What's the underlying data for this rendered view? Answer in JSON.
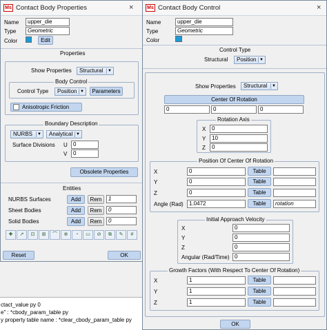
{
  "console": {
    "lines": [
      "ctact_value py 0",
      "e\" : *cbody_param_table py",
      "y property table name : *clear_cbody_param_table py"
    ]
  },
  "left_window": {
    "logo": "Ms",
    "title": "Contact Body Properties",
    "close": "×",
    "name_label": "Name",
    "name_value": "upper_die",
    "type_label": "Type",
    "type_value": "Geometric",
    "color_label": "Color",
    "edit_label": "Edit",
    "color_hex": "#1d9bd6",
    "properties_title": "Properties",
    "show_properties_label": "Show Properties",
    "show_properties_value": "Structural",
    "body_control_title": "Body Control",
    "control_type_label": "Control Type",
    "control_type_value": "Position",
    "parameters_label": "Parameters",
    "anisotropic_label": "Anisotropic Friction",
    "boundary_title": "Boundary Description",
    "nurbs_value": "NURBS",
    "analytical_value": "Analytical",
    "surface_divisions_label": "Surface Divisions",
    "u_label": "U",
    "u_value": "0",
    "v_label": "V",
    "v_value": "0",
    "obsolete_label": "Obsolete Properties",
    "entities_title": "Entities",
    "entity_rows": [
      {
        "label": "NURBS Surfaces",
        "add": "Add",
        "rem": "Rem",
        "value": "1"
      },
      {
        "label": "Sheet Bodies",
        "add": "Add",
        "rem": "Rem",
        "value": "0"
      },
      {
        "label": "Solid Bodies",
        "add": "Add",
        "rem": "Rem",
        "value": "0"
      }
    ],
    "tool_icons": [
      "✚",
      "↗",
      "⊡",
      "⊞",
      "⌒",
      "⊕",
      "◔",
      "▭",
      "⊘",
      "⧉",
      "✎",
      "#"
    ],
    "reset_label": "Reset",
    "ok_label": "OK"
  },
  "right_window": {
    "logo": "Ms",
    "title": "Contact Body Control",
    "close": "×",
    "name_label": "Name",
    "name_value": "upper_die",
    "type_label": "Type",
    "type_value": "Geometric",
    "color_label": "Color",
    "color_hex": "#1d9bd6",
    "control_type_title": "Control Type",
    "structural_label": "Structural",
    "position_value": "Position",
    "show_properties_label": "Show Properties",
    "show_properties_value": "Structural",
    "center_of_rotation_label": "Center Of Rotation",
    "cor_values": [
      "0",
      "0",
      "0"
    ],
    "rotation_axis_title": "Rotation Axis",
    "axis_rows": [
      {
        "label": "X",
        "value": "0"
      },
      {
        "label": "Y",
        "value": "10"
      },
      {
        "label": "Z",
        "value": "0"
      }
    ],
    "poscor_title": "Position Of Center Of Rotation",
    "poscor_rows": [
      {
        "label": "X",
        "value": "0",
        "table": "Table",
        "extra": ""
      },
      {
        "label": "Y",
        "value": "0",
        "table": "Table",
        "extra": ""
      },
      {
        "label": "Z",
        "value": "0",
        "table": "Table",
        "extra": ""
      },
      {
        "label": "Angle (Rad)",
        "value": "1.0472",
        "table": "Table",
        "extra": "rotation"
      }
    ],
    "approach_title": "Initial Approach Velocity",
    "approach_rows": [
      {
        "label": "X",
        "value": "0"
      },
      {
        "label": "Y",
        "value": "0"
      },
      {
        "label": "Z",
        "value": "0"
      },
      {
        "label": "Angular (Rad/Time)",
        "value": "0"
      }
    ],
    "growth_title": "Growth Factors (With Respect To Center Of Rotation)",
    "growth_rows": [
      {
        "label": "X",
        "value": "1",
        "table": "Table"
      },
      {
        "label": "Y",
        "value": "1",
        "table": "Table"
      },
      {
        "label": "Z",
        "value": "1",
        "table": "Table"
      }
    ],
    "ok_label": "OK"
  }
}
